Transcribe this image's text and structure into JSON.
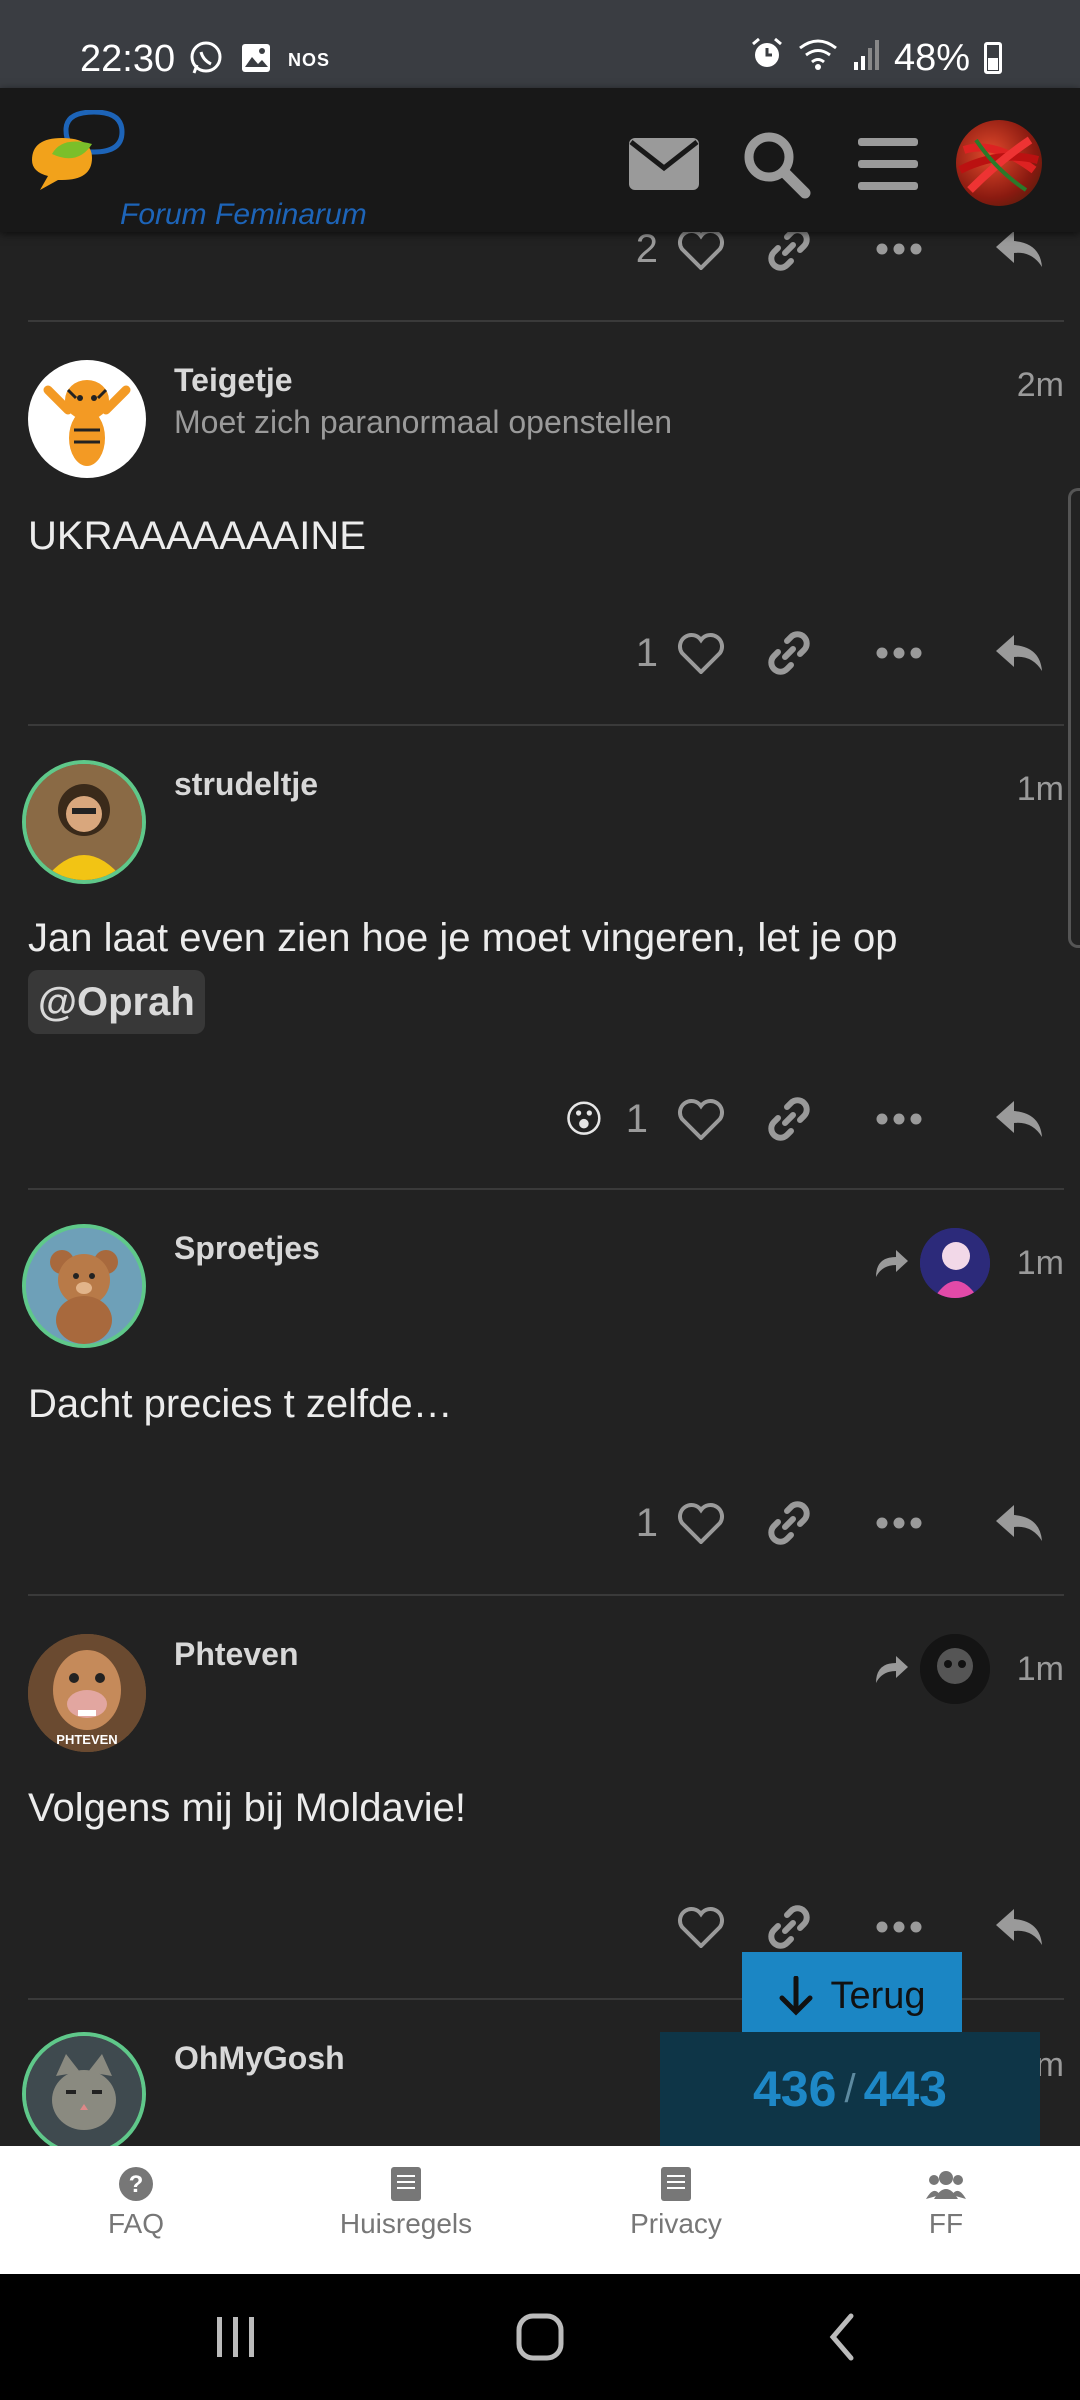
{
  "status_bar": {
    "time": "22:30",
    "nos_label": "NOS",
    "battery": "48%"
  },
  "header": {
    "site_name": "Forum Feminarum"
  },
  "posts": [
    {
      "likes": "2"
    },
    {
      "username": "Teigetje",
      "title": "Moet zich paranormaal openstellen",
      "time": "2m",
      "body": "UKRAAAAAAAINE",
      "likes": "1"
    },
    {
      "username": "strudeltje",
      "time": "1m",
      "body": "Jan laat even zien hoe je moet vingeren, let je op",
      "mention": "@Oprah",
      "reaction": "😮",
      "likes": "1"
    },
    {
      "username": "Sproetjes",
      "time": "1m",
      "body": "Dacht precies t zelfde…",
      "likes": "1"
    },
    {
      "username": "Phteven",
      "time": "1m",
      "body": "Volgens mij bij Moldavie!",
      "avatar_caption": "PHTEVEN"
    },
    {
      "username": "OhMyGosh",
      "time": "1m"
    }
  ],
  "timeline": {
    "back_label": "Terug",
    "current": "436",
    "total": "443"
  },
  "footer": {
    "items": [
      "FAQ",
      "Huisregels",
      "Privacy",
      "FF"
    ]
  },
  "colors": {
    "accent": "#1b86c4",
    "ring": "#5fc88a",
    "background": "#222222"
  }
}
